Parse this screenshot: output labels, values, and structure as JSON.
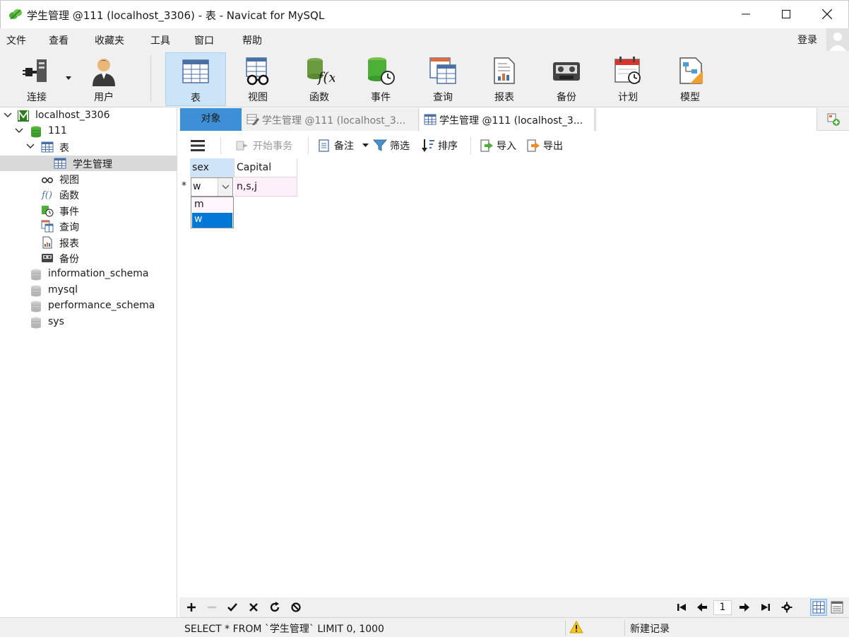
{
  "window": {
    "title": "学生管理 @111 (localhost_3306) - 表 - Navicat for MySQL",
    "icon": "navicat-leaf-icon"
  },
  "menu": {
    "items": [
      "文件",
      "查看",
      "收藏夹",
      "工具",
      "窗口",
      "帮助"
    ],
    "login": "登录"
  },
  "toolbar": {
    "buttons": [
      {
        "label": "连接",
        "icon": "connection-plug-icon"
      },
      {
        "label": "用户",
        "icon": "user-icon"
      },
      {
        "label": "表",
        "icon": "table-icon",
        "active": true
      },
      {
        "label": "视图",
        "icon": "view-glasses-icon"
      },
      {
        "label": "函数",
        "icon": "function-icon"
      },
      {
        "label": "事件",
        "icon": "event-clock-icon"
      },
      {
        "label": "查询",
        "icon": "query-icon"
      },
      {
        "label": "报表",
        "icon": "report-icon"
      },
      {
        "label": "备份",
        "icon": "backup-tape-icon"
      },
      {
        "label": "计划",
        "icon": "schedule-calendar-icon"
      },
      {
        "label": "模型",
        "icon": "model-icon"
      }
    ]
  },
  "sidebar": {
    "connection": "localhost_3306",
    "database": "111",
    "tables_group": "表",
    "selected_table": "学生管理",
    "groups": [
      "视图",
      "函数",
      "事件",
      "查询",
      "报表",
      "备份"
    ],
    "other_databases": [
      "information_schema",
      "mysql",
      "performance_schema",
      "sys"
    ]
  },
  "tabs": {
    "objects": "对象",
    "tab1": "学生管理 @111 (localhost_3...",
    "tab2": "学生管理 @111 (localhost_3..."
  },
  "subtoolbar": {
    "begin_transaction": "开始事务",
    "memo": "备注",
    "filter": "筛选",
    "sort": "排序",
    "import": "导入",
    "export": "导出"
  },
  "grid": {
    "columns": [
      "sex",
      "Capital"
    ],
    "new_row_marker": "*",
    "editing_value": "w",
    "capital_value": "n,s,j",
    "dropdown_options": [
      "m",
      "w"
    ],
    "dropdown_selected": "w"
  },
  "pager": {
    "page": "1"
  },
  "status": {
    "sql": "SELECT * FROM `学生管理` LIMIT 0, 1000",
    "state": "新建记录"
  },
  "colors": {
    "accent": "#0078d7",
    "tab_active": "#3d8fd6",
    "toolbar_active": "#cce4f7",
    "new_row": "#fdf0fb"
  }
}
